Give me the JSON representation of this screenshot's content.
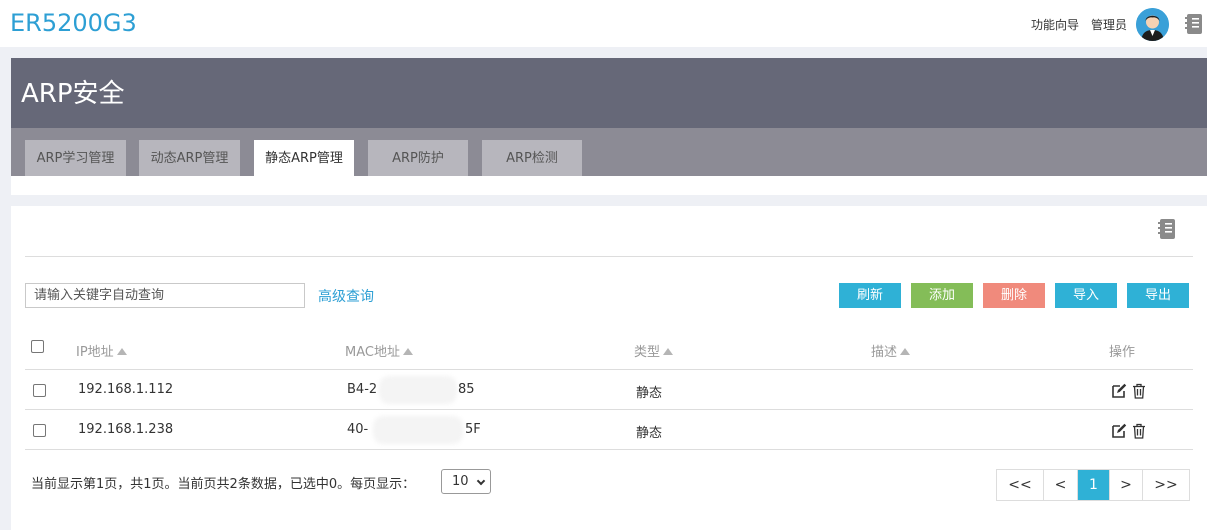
{
  "header": {
    "brand": "ER5200G3",
    "wizard_link": "功能向导",
    "admin_link": "管理员"
  },
  "page": {
    "title": "ARP安全",
    "tabs": [
      {
        "label": "ARP学习管理",
        "active": false
      },
      {
        "label": "动态ARP管理",
        "active": false
      },
      {
        "label": "静态ARP管理",
        "active": true
      },
      {
        "label": "ARP防护",
        "active": false
      },
      {
        "label": "ARP检测",
        "active": false
      }
    ]
  },
  "toolbar": {
    "search_placeholder": "请输入关键字自动查询",
    "advanced_search": "高级查询",
    "refresh": "刷新",
    "add": "添加",
    "delete": "删除",
    "import": "导入",
    "export": "导出"
  },
  "table": {
    "columns": [
      "IP地址",
      "MAC地址",
      "类型",
      "描述",
      "操作"
    ],
    "rows": [
      {
        "ip": "192.168.1.112",
        "mac_prefix": "B4-2",
        "mac_suffix": "85",
        "type": "静态",
        "description": ""
      },
      {
        "ip": "192.168.1.238",
        "mac_prefix": "40-",
        "mac_suffix": "5F",
        "type": "静态",
        "description": ""
      }
    ]
  },
  "footer": {
    "status": "当前显示第1页，共1页。当前页共2条数据，已选中0。每页显示：",
    "page_size": "10"
  },
  "pagination": {
    "first": "<<",
    "prev": "<",
    "current": "1",
    "next": ">",
    "last": ">>"
  },
  "colors": {
    "brand": "#2d9fd4",
    "title_panel": "#666878",
    "tab_bar": "#8c8b95",
    "refresh": "#2fb1d6",
    "add": "#84bd58",
    "delete": "#f08a7c"
  }
}
